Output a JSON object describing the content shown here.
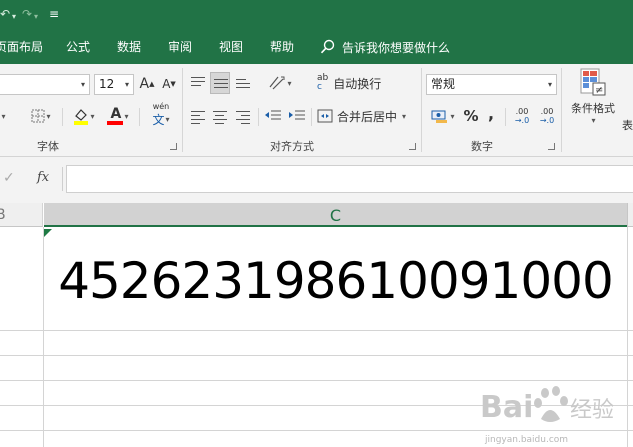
{
  "quick_access": {
    "undo_arrow": "↶",
    "redo_arrow": "↷",
    "more": "▾",
    "customize": "≡"
  },
  "menu": {
    "items": [
      "页面布局",
      "公式",
      "数据",
      "审阅",
      "视图",
      "帮助"
    ],
    "tellme": "告诉我你想要做什么"
  },
  "ribbon": {
    "font": {
      "label": "字体",
      "size": "12",
      "grow": "A",
      "shrink": "A",
      "wen": "wén",
      "wen_char": "文",
      "color_a": "A",
      "fill_color": "#ffff00",
      "font_color": "#ff0000"
    },
    "alignment": {
      "label": "对齐方式",
      "wrap_text": "自动换行",
      "merge_center": "合并后居中",
      "wrap_icon": "ab",
      "wrap_icon_c": "c"
    },
    "number": {
      "label": "数字",
      "format": "常规",
      "percent": "%",
      "comma": ",",
      "inc_decimal": ".00",
      "inc_decimal_b": "→.0",
      "dec_decimal": ".00",
      "dec_decimal_b": "→.0"
    },
    "styles": {
      "conditional_format": "条件格式",
      "table_partial": "表"
    }
  },
  "formula_bar": {
    "check": "✓",
    "fx": "fx",
    "value": ""
  },
  "grid": {
    "col_b": "B",
    "col_c": "C",
    "cell_value": "452623198610091000"
  },
  "watermark": {
    "url": "jingyan.baidu.com"
  },
  "colors": {
    "excel_green": "#217346"
  }
}
